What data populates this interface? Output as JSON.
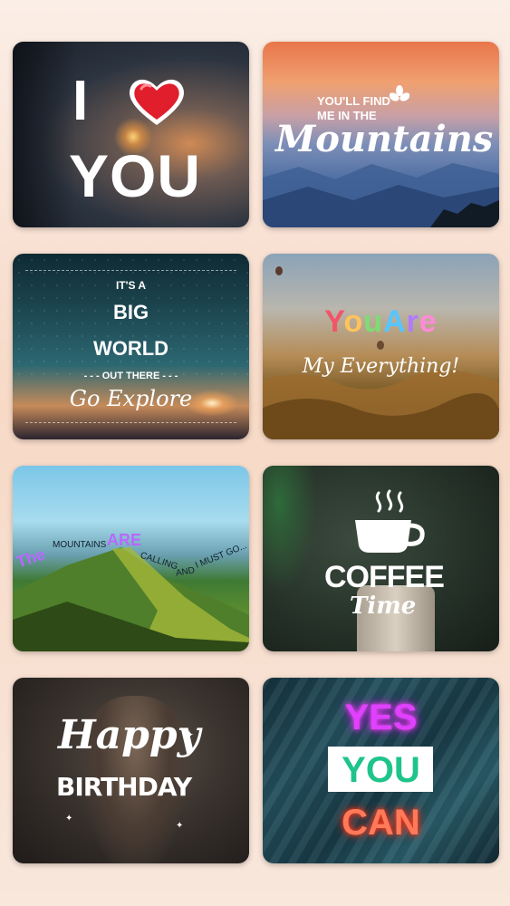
{
  "cards": [
    {
      "id": "love",
      "line1": "I",
      "line2": "YOU"
    },
    {
      "id": "mountains",
      "small1": "YOU'LL FIND",
      "small2": "ME IN THE",
      "script": "Mountains"
    },
    {
      "id": "world",
      "l1": "IT'S A",
      "l2": "BIG",
      "l3": "WORLD",
      "l4": "- - - OUT THERE - - -",
      "script": "Go Explore"
    },
    {
      "id": "everything",
      "letters": [
        "Y",
        "o",
        "u",
        "A",
        "r",
        "e"
      ],
      "letter_colors": [
        "#f2546a",
        "#ffc35c",
        "#7ddc74",
        "#55c6ff",
        "#b07bff",
        "#ff8ad8"
      ],
      "script": "My Everything!"
    },
    {
      "id": "calling",
      "w1": "The",
      "w2": "MOUNTAINS",
      "w3": "ARE",
      "w4": "CALLING",
      "w5": "AND",
      "w6": "I MUST GO..."
    },
    {
      "id": "coffee",
      "title": "COFFEE",
      "script": "Time"
    },
    {
      "id": "birthday",
      "script": "Happy",
      "title": "BIRTHDAY"
    },
    {
      "id": "yes",
      "w1": "YES",
      "w2": "YOU",
      "w3": "CAN"
    }
  ]
}
